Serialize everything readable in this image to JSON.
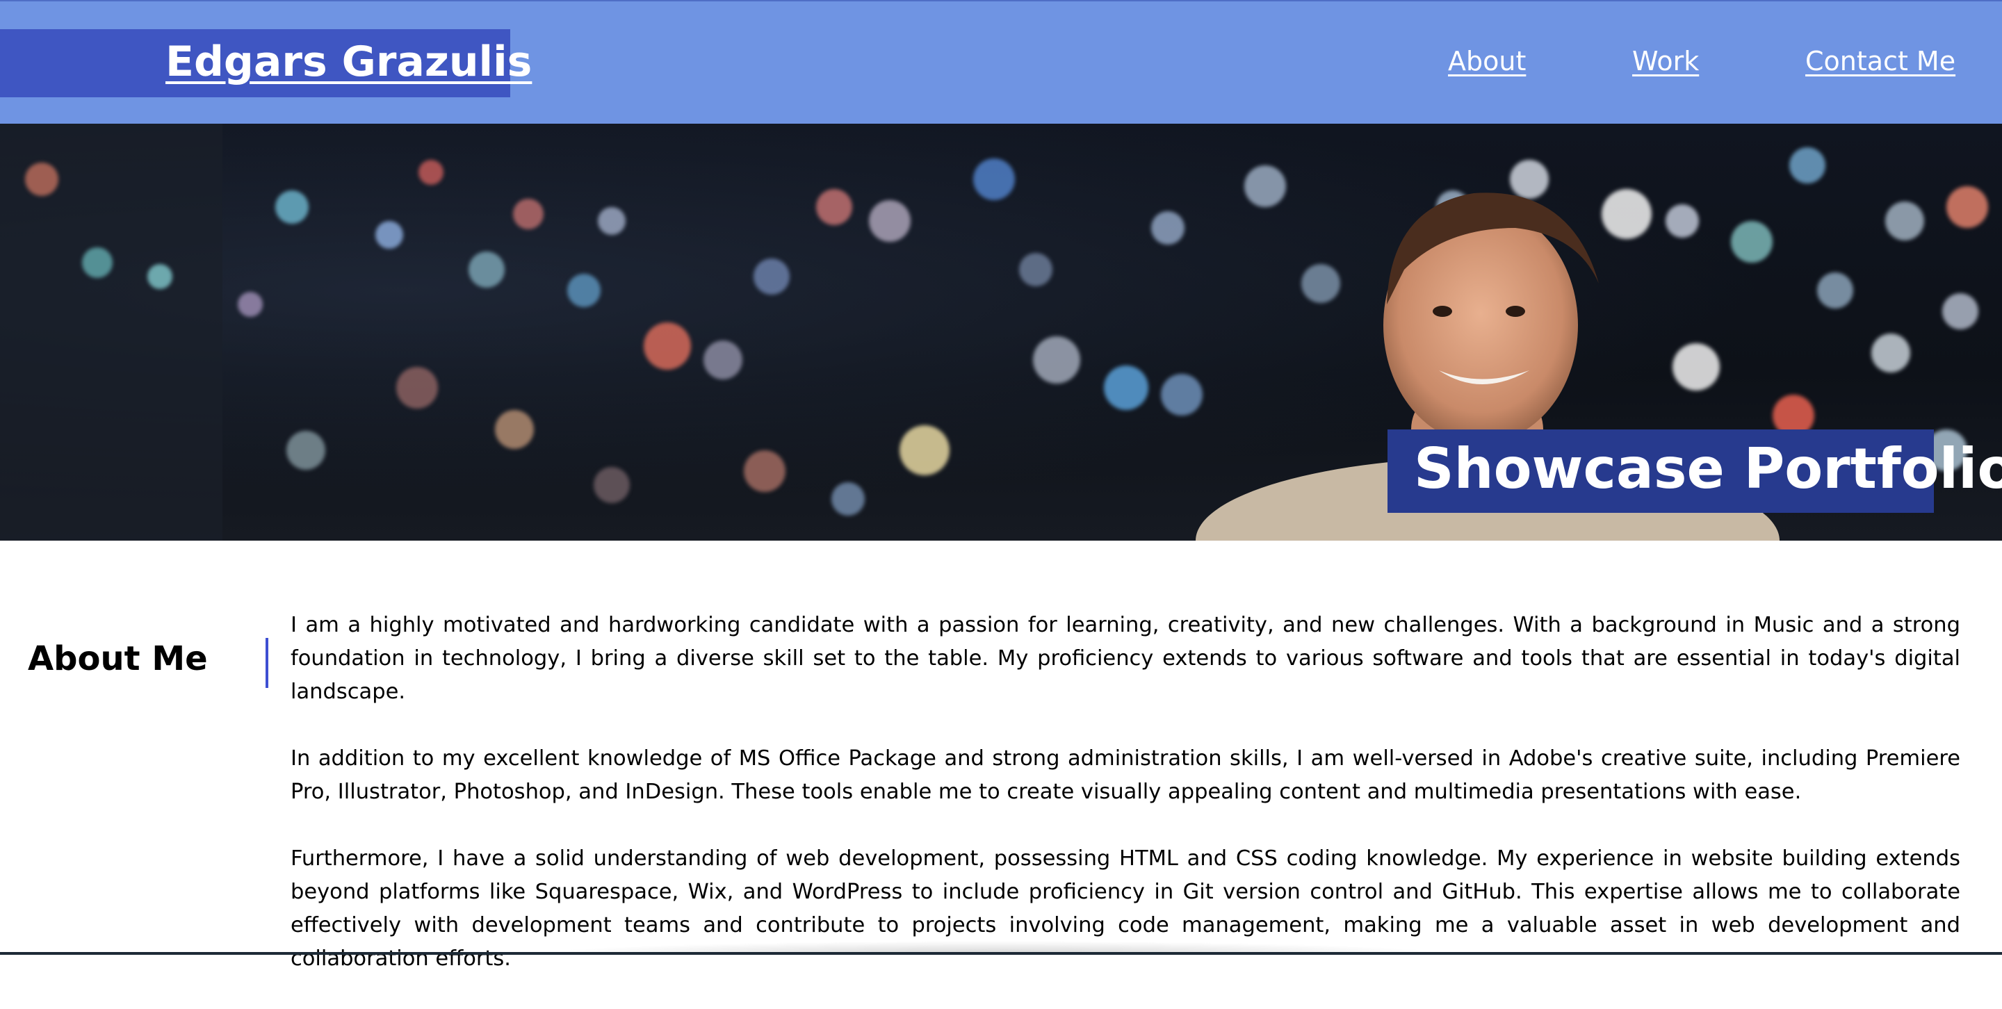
{
  "header": {
    "logo": "Edgars Grazulis",
    "nav": [
      "About",
      "Work",
      "Contact Me"
    ]
  },
  "hero": {
    "banner_title": "Showcase Portfolio"
  },
  "about": {
    "title": "About Me",
    "paragraphs": [
      "I am a highly motivated and hardworking candidate with a passion for learning, creativity, and new challenges. With a background in Music and a strong foundation in technology, I bring a diverse skill set to the table. My proficiency extends to various software and tools that are essential in today's digital landscape.",
      "In addition to my excellent knowledge of MS Office Package and strong administration skills, I am well-versed in Adobe's creative suite, including Premiere Pro, Illustrator, Photoshop, and InDesign. These tools enable me to create visually appealing content and multimedia presentations with ease.",
      "Furthermore, I have a solid understanding of web development, possessing HTML and CSS coding knowledge. My experience in website building extends beyond platforms like Squarespace, Wix, and WordPress to include proficiency in Git version control and GitHub. This expertise allows me to collaborate effectively with development teams and contribute to projects involving code management, making me a valuable asset in web development and collaboration efforts."
    ]
  },
  "colors": {
    "header_bg": "#6f94e3",
    "logo_box": "#3f56c2",
    "banner_bg": "#273a8e",
    "accent_rule": "#3e4fd2"
  }
}
